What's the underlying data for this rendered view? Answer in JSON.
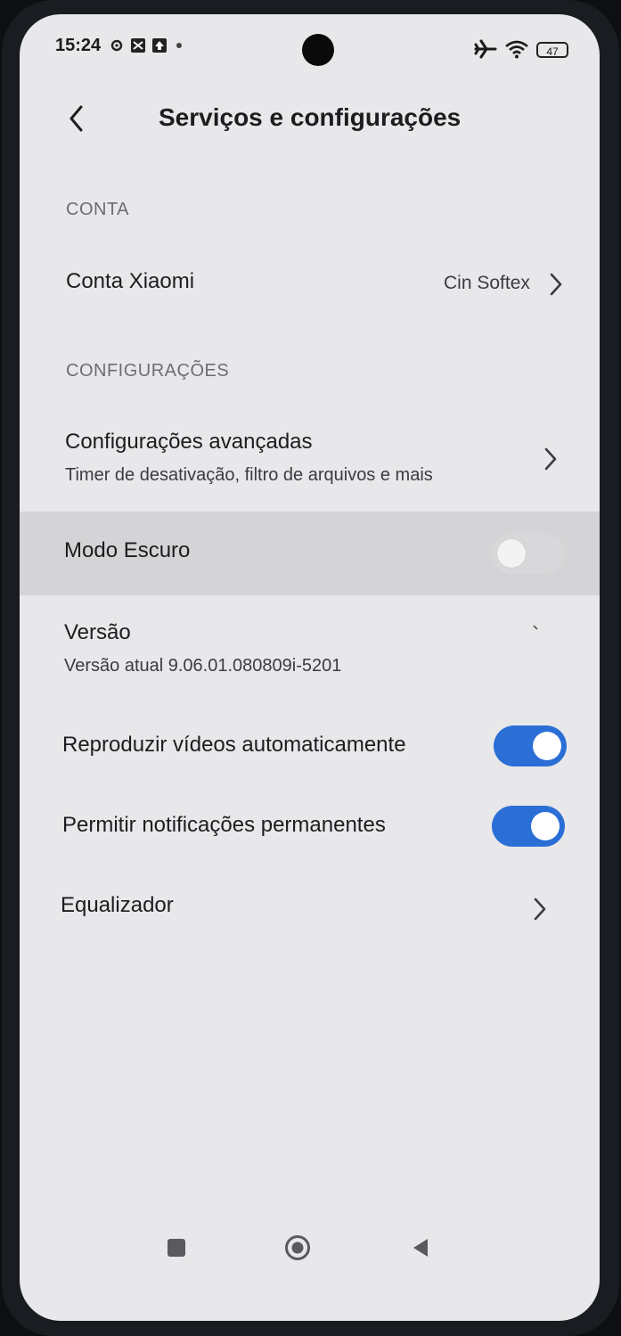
{
  "status_bar": {
    "time": "15:24",
    "battery": "47"
  },
  "header": {
    "title": "Serviços e configurações"
  },
  "account_section": {
    "label": "CONTA",
    "account": {
      "title": "Conta Xiaomi",
      "value": "Cin Softex"
    }
  },
  "settings_section": {
    "label": "CONFIGURAÇÕES",
    "advanced": {
      "title": "Configurações avançadas",
      "subtitle": "Timer de desativação, filtro de arquivos e mais"
    },
    "dark_mode": {
      "title": "Modo Escuro",
      "enabled": false
    },
    "version": {
      "title": "Versão",
      "subtitle": "Versão atual 9.06.01.080809i-5201"
    },
    "autoplay": {
      "title": "Reproduzir vídeos automaticamente",
      "enabled": true
    },
    "notifications": {
      "title": "Permitir notificações permanentes",
      "enabled": true
    },
    "equalizer": {
      "title": "Equalizador"
    }
  },
  "colors": {
    "accent": "#2b6fd6",
    "background": "#e8e8ea",
    "highlight": "#d4d4d6"
  }
}
